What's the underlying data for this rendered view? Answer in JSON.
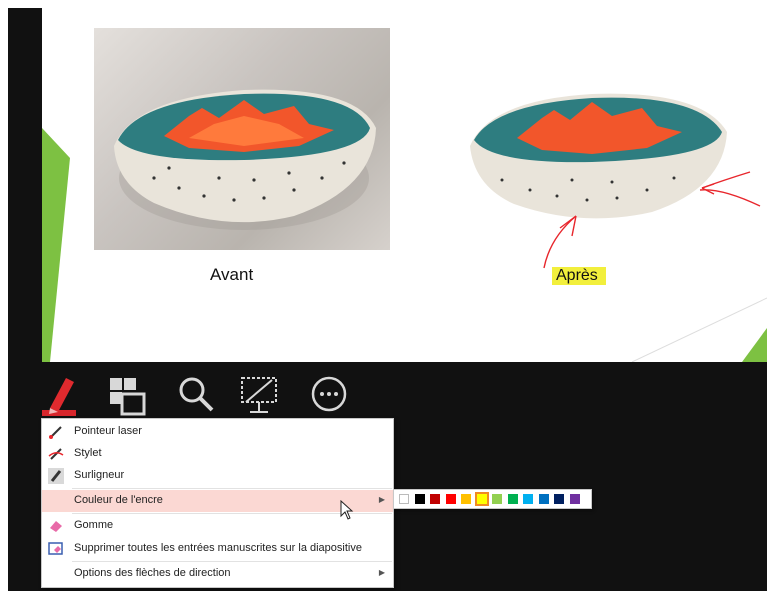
{
  "slide": {
    "label_before": "Avant",
    "label_after": "Après",
    "highlight_color": "#f2ef3c",
    "ink_color": "#e8262c"
  },
  "toolbar": {
    "tools": [
      "pen-icon",
      "grid-icon",
      "magnifier-icon",
      "screen-icon",
      "more-icon"
    ]
  },
  "menu": {
    "items": [
      {
        "label": "Pointeur laser",
        "icon": "laser-pointer-icon"
      },
      {
        "label": "Stylet",
        "icon": "pen-icon"
      },
      {
        "label": "Surligneur",
        "icon": "highlighter-icon"
      },
      {
        "label": "Couleur de l'encre",
        "icon": "",
        "submenu": true,
        "highlighted": true
      },
      {
        "label": "Gomme",
        "icon": "eraser-icon"
      },
      {
        "label": "Supprimer toutes les entrées manuscrites sur la diapositive",
        "icon": "erase-all-icon"
      },
      {
        "label": "Options des flèches de direction",
        "icon": "",
        "submenu": true
      }
    ]
  },
  "palette": {
    "colors": [
      "#ffffff",
      "#000000",
      "#c00000",
      "#ff0000",
      "#ffc000",
      "#ffff00",
      "#92d050",
      "#00b050",
      "#00b0f0",
      "#0070c0",
      "#002060",
      "#7030a0"
    ],
    "selected_index": 5
  }
}
